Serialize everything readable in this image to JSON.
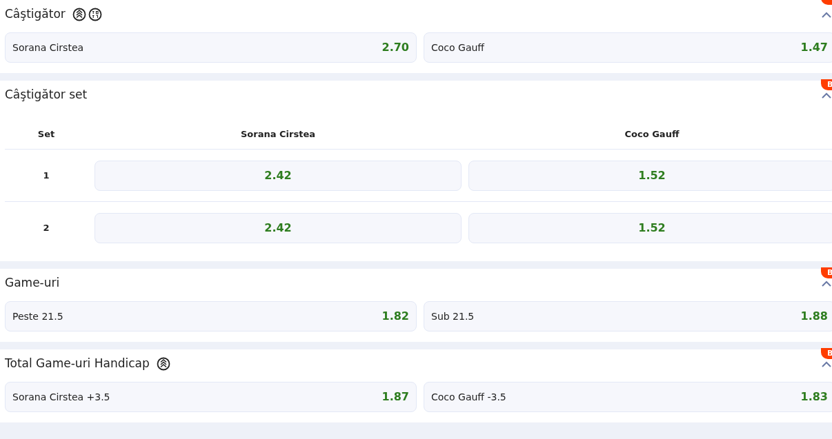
{
  "markets": [
    {
      "kind": "pair",
      "title": "Câştigător",
      "icons": [
        {
          "kind": "stack"
        },
        {
          "kind": "score"
        }
      ],
      "expanded": true,
      "odds": [
        {
          "label": "Sorana Cirstea",
          "value": "2.70"
        },
        {
          "label": "Coco Gauff",
          "value": "1.47"
        }
      ]
    },
    {
      "kind": "table",
      "title": "Câştigător set",
      "badge": "B",
      "expanded": true,
      "columns": [
        "Set",
        "Sorana Cirstea",
        "Coco Gauff"
      ],
      "rows": [
        {
          "set": "1",
          "odds": [
            "2.42",
            "1.52"
          ]
        },
        {
          "set": "2",
          "odds": [
            "2.42",
            "1.52"
          ]
        }
      ]
    },
    {
      "kind": "pair",
      "title": "Game-uri",
      "badge": "B",
      "expanded": true,
      "odds": [
        {
          "label": "Peste 21.5",
          "value": "1.82"
        },
        {
          "label": "Sub 21.5",
          "value": "1.88"
        }
      ]
    },
    {
      "kind": "pair",
      "title": "Total Game-uri Handicap",
      "icons": [
        {
          "kind": "stack"
        }
      ],
      "badge": "B",
      "expanded": true,
      "odds": [
        {
          "label": "Sorana Cirstea +3.5",
          "value": "1.87"
        },
        {
          "label": "Coco Gauff -3.5",
          "value": "1.83"
        }
      ]
    }
  ]
}
